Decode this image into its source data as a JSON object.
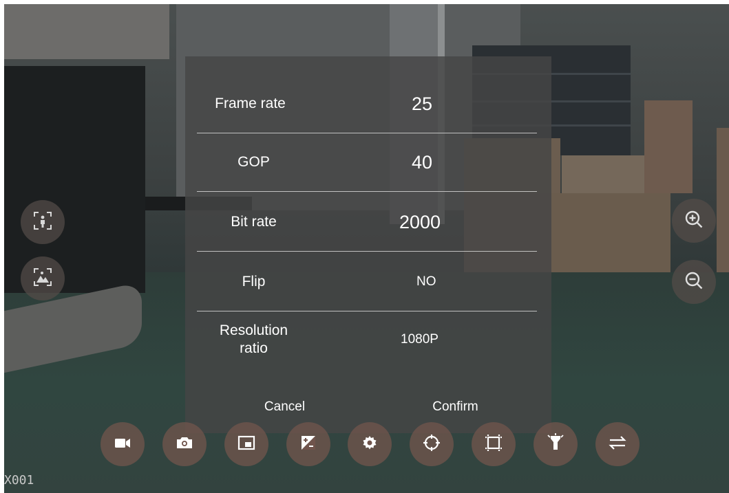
{
  "settings": {
    "rows": [
      {
        "label": "Frame rate",
        "value": "25"
      },
      {
        "label": "GOP",
        "value": "40"
      },
      {
        "label": "Bit rate",
        "value": "2000"
      },
      {
        "label": "Flip",
        "value": "NO"
      },
      {
        "label": "Resolution\nratio",
        "value": "1080P"
      }
    ],
    "cancel_label": "Cancel",
    "confirm_label": "Confirm"
  },
  "side_controls": {
    "left": [
      "person-focus-icon",
      "scene-focus-icon"
    ],
    "right": [
      "zoom-in-icon",
      "zoom-out-icon"
    ]
  },
  "toolbar": {
    "items": [
      "video-record-icon",
      "camera-icon",
      "picture-in-picture-icon",
      "exposure-icon",
      "settings-gear-icon",
      "crosshair-icon",
      "crop-frame-icon",
      "flashlight-icon",
      "swap-arrows-icon"
    ]
  },
  "camera_id": "X001",
  "colors": {
    "dialog_bg": "#464646",
    "toolbar_button": "#70544c",
    "icon": "#ffffff"
  }
}
